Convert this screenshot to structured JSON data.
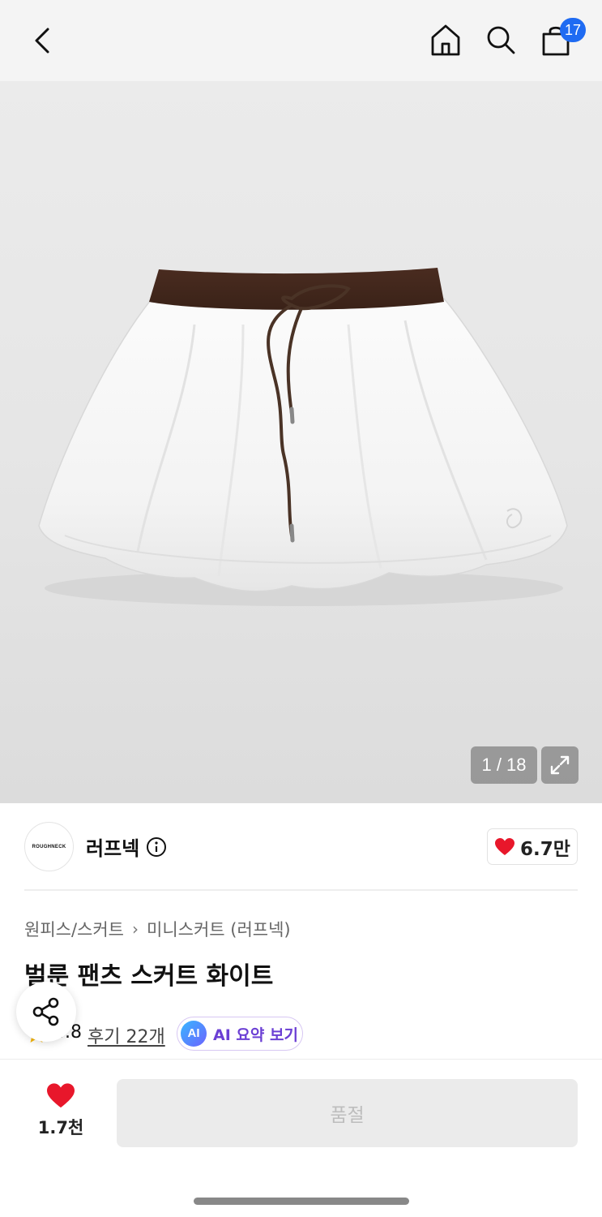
{
  "header": {
    "cart_count": "17"
  },
  "gallery": {
    "counter": "1 / 18"
  },
  "brand": {
    "logo_text": "ROUGHNECK",
    "name": "러프넥",
    "like_count": "6.7만"
  },
  "breadcrumb": {
    "category": "원피스/스커트",
    "separator": "›",
    "subcategory": "미니스커트 (러프넥)"
  },
  "product": {
    "title": "벌룬 팬츠 스커트 화이트",
    "rating": "4.8",
    "reviews_label": "후기 22개",
    "ai_badge": "AI",
    "ai_summary_label": "AI 요약 보기"
  },
  "bottom": {
    "like_count": "1.7천",
    "soldout_label": "품절"
  },
  "colors": {
    "accent_blue": "#1f6bf2",
    "heart_red": "#e8172b",
    "ai_purple": "#6b3fd4"
  }
}
